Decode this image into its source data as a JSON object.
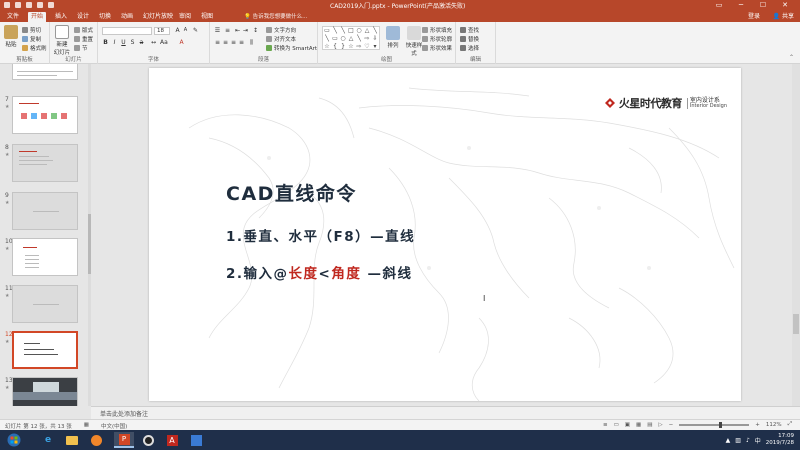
{
  "window": {
    "title": "CAD2019入门.pptx - PowerPoint(产品激活失败)",
    "user": "登录",
    "share": "共享",
    "controls": [
      "▭",
      "─",
      "☐",
      "✕"
    ]
  },
  "ribbon_tabs": [
    "文件",
    "开始",
    "插入",
    "设计",
    "切换",
    "动画",
    "幻灯片放映",
    "审阅",
    "视图"
  ],
  "active_tab": "开始",
  "tell_me": "告诉我您想要做什么...",
  "ribbon": {
    "clipboard": {
      "paste": "粘贴",
      "cut": "剪切",
      "copy": "复制",
      "format_painter": "格式刷",
      "label": "剪贴板"
    },
    "slides": {
      "new_slide": "新建\n幻灯片",
      "layout": "版式",
      "reset": "重置",
      "section": "节",
      "label": "幻灯片"
    },
    "font": {
      "name": "",
      "size": "18",
      "label": "字体"
    },
    "paragraph": {
      "text_direction": "文字方向",
      "align_text": "对齐文本",
      "smartart": "转换为 SmartArt",
      "label": "段落"
    },
    "drawing": {
      "arrange": "排列",
      "quick_styles": "快速样式",
      "shape_fill": "形状填充",
      "shape_outline": "形状轮廓",
      "shape_effects": "形状效果",
      "label": "绘图"
    },
    "editing": {
      "find": "查找",
      "replace": "替换",
      "select": "选择",
      "label": "编辑"
    }
  },
  "thumbnails": [
    {
      "num": "",
      "style": "white"
    },
    {
      "num": "7",
      "style": "white"
    },
    {
      "num": "8",
      "style": "gray"
    },
    {
      "num": "9",
      "style": "gray"
    },
    {
      "num": "10",
      "style": "white"
    },
    {
      "num": "11",
      "style": "gray"
    },
    {
      "num": "12",
      "style": "white",
      "selected": true
    },
    {
      "num": "13",
      "style": "dark"
    }
  ],
  "slide": {
    "logo_brand": "火星时代教育",
    "logo_sub1": "室内设计系",
    "logo_sub2": "Interior Design",
    "title": "CAD直线命令",
    "line1": "1.垂直、水平（F8）—直线",
    "line2_a": "2.输入@",
    "line2_b": "长度",
    "line2_c": "<",
    "line2_d": "角度",
    "line2_e": " —斜线"
  },
  "notes_placeholder": "单击此处添加备注",
  "status": {
    "slide_info": "幻灯片 第 12 张，共 13 张",
    "language": "中文(中国)",
    "zoom": "112%"
  },
  "taskbar": {
    "time": "17:09",
    "date": "2019/7/28"
  },
  "colors": {
    "accent": "#b7472a",
    "title_text": "#1f2d3d",
    "highlight_red": "#c0281f"
  }
}
